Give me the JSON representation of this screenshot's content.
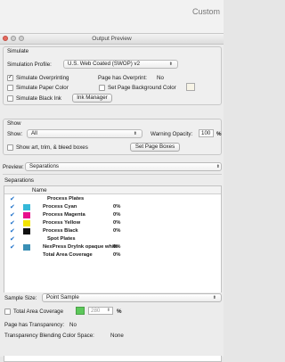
{
  "custom_label": "Custom",
  "window": {
    "title": "Output Preview"
  },
  "simulate": {
    "heading": "Simulate",
    "profile_label": "Simulation Profile:",
    "profile_value": "U.S. Web Coated (SWOP) v2",
    "overprinting_label": "Simulate Overprinting",
    "overprinting_checked": true,
    "page_overprint_label": "Page has Overprint:",
    "page_overprint_value": "No",
    "paper_color_label": "Simulate Paper Color",
    "bg_color_label": "Set Page Background Color",
    "black_ink_label": "Simulate Black Ink",
    "ink_manager_label": "Ink Manager"
  },
  "show": {
    "heading": "Show",
    "show_label": "Show:",
    "show_value": "All",
    "warning_label": "Warning Opacity:",
    "warning_value": "100",
    "warning_unit": "%",
    "artbox_label": "Show art, trim, & bleed boxes",
    "page_boxes_label": "Set Page Boxes"
  },
  "preview": {
    "label": "Preview:",
    "value": "Separations"
  },
  "separations": {
    "heading": "Separations",
    "column_name": "Name",
    "rows": [
      {
        "name": "Process Plates",
        "percent": "",
        "color": "",
        "checked": true
      },
      {
        "name": "Process Cyan",
        "percent": "0%",
        "color": "#35b8d8",
        "checked": true
      },
      {
        "name": "Process Magenta",
        "percent": "0%",
        "color": "#e8108c",
        "checked": true
      },
      {
        "name": "Process Yellow",
        "percent": "0%",
        "color": "#f2e400",
        "checked": true
      },
      {
        "name": "Process Black",
        "percent": "0%",
        "color": "#111111",
        "checked": true
      },
      {
        "name": "Spot Plates",
        "percent": "",
        "color": "",
        "checked": true
      },
      {
        "name": "NexPress Drylnk opaque white",
        "percent": "0%",
        "color": "#3a8fb5",
        "checked": true
      },
      {
        "name": "Total Area Coverage",
        "percent": "0%",
        "color": "",
        "checked": false
      }
    ],
    "sample_size_label": "Sample Size:",
    "sample_size_value": "Point Sample",
    "total_coverage_label": "Total Area Coverage",
    "total_coverage_color": "#5cc85a",
    "total_coverage_value": "280",
    "total_coverage_unit": "%",
    "page_transparency_label": "Page has Transparency:",
    "page_transparency_value": "No",
    "blend_space_label": "Transparency Blending Color Space:",
    "blend_space_value": "None"
  }
}
